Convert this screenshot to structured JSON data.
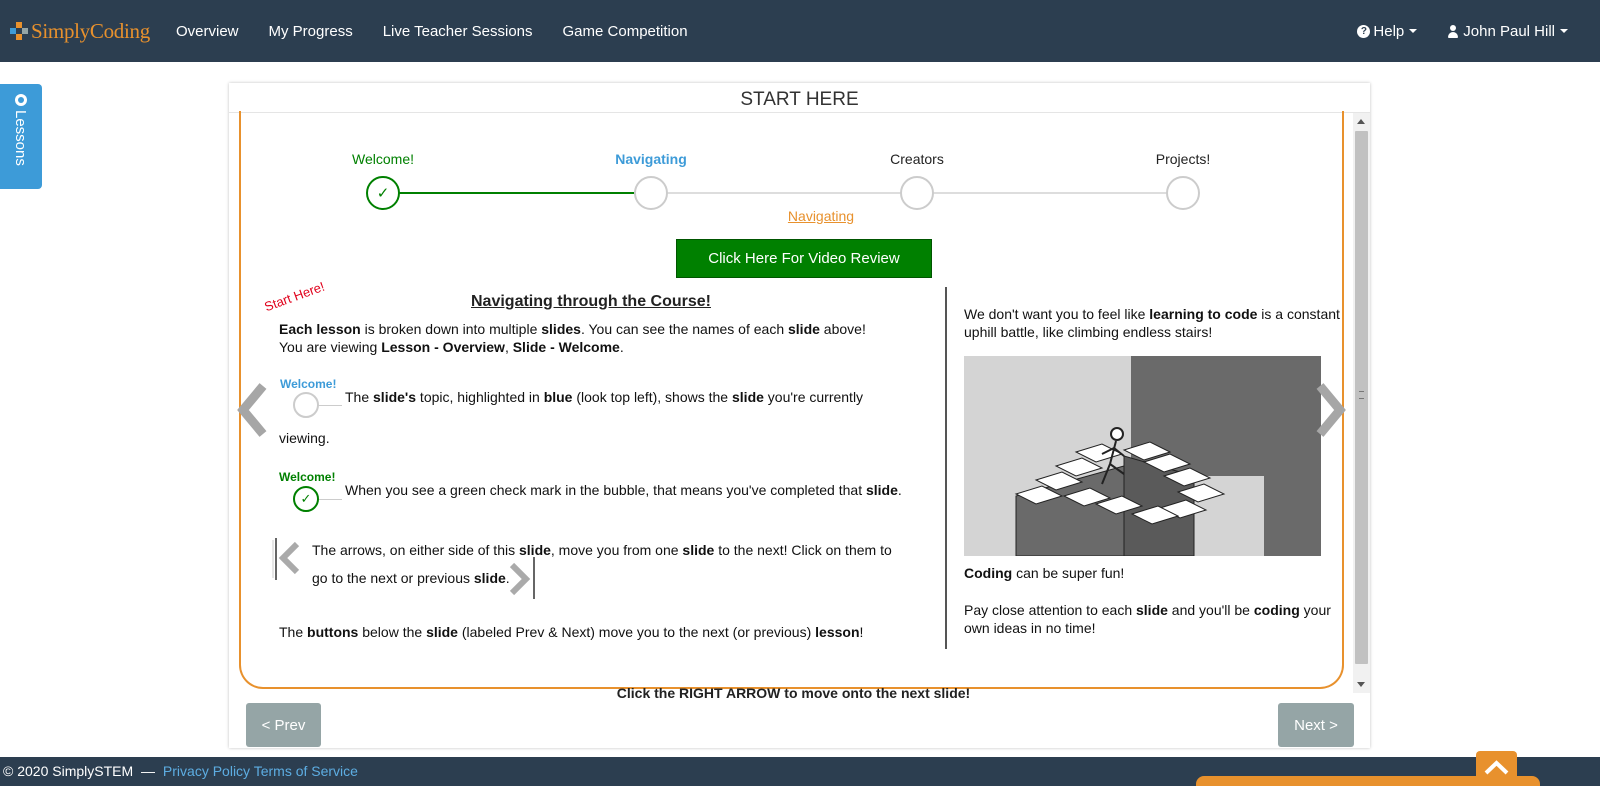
{
  "brand": {
    "name": "SimplyCoding"
  },
  "nav": {
    "links": [
      "Overview",
      "My Progress",
      "Live Teacher Sessions",
      "Game Competition"
    ],
    "help": "Help",
    "user": "John Paul Hill"
  },
  "sidebar": {
    "lessons_tab": "Lessons"
  },
  "panel": {
    "title": "START HERE"
  },
  "steps": [
    {
      "label": "Welcome!",
      "status": "completed",
      "check": "✓"
    },
    {
      "label": "Navigating",
      "status": "current",
      "check": ""
    },
    {
      "label": "Creators",
      "status": "upcoming",
      "check": ""
    },
    {
      "label": "Projects!",
      "status": "upcoming",
      "check": ""
    }
  ],
  "slide": {
    "current_link": "Navigating",
    "video_button": "Click Here For Video Review",
    "start_here": "Start Here!",
    "title": "Navigating through the Course!",
    "demo_label_current": "Welcome!",
    "demo_label_done": "Welcome!",
    "demo_check": "✓",
    "bottom_cta": "Click the RIGHT ARROW to move onto the next slide!",
    "left_paragraphs": [
      "<b>Each lesson</b> is broken down into multiple <b>slides</b>. You can see the names of each <b>slide</b> above!<br>You are viewing <b>Lesson - Overview</b>, <b>Slide - Welcome</b>.",
      "The <b>slide's</b> topic, highlighted in <b>blue</b> (look top left), shows the <b>slide</b> you're currently",
      "viewing.",
      "When you see a green check mark in the bubble, that means you've completed that <b>slide</b>.",
      "The arrows, on either side of this <b>slide</b>, move you from one <b>slide</b> to the next! Click on them to",
      "go to the next or previous <b>slide</b>.",
      "The <b>buttons</b> below the <b>slide</b> (labeled Prev &amp; Next) move you to the next (or previous) <b>lesson</b>!"
    ],
    "right_paragraphs": [
      "We don't want you to feel like <b>learning to code</b> is a constant uphill battle, like climbing endless stairs!",
      "<b>Coding</b> can be super fun!",
      "Pay close attention to each <b>slide</b> and you'll be <b>coding</b> your own ideas in no time!"
    ]
  },
  "buttons": {
    "prev": "< Prev",
    "next": "Next >"
  },
  "footer": {
    "copyright": "© 2020 SimplySTEM",
    "sep": "—",
    "privacy": "Privacy Policy",
    "terms": "Terms of Service"
  },
  "colors": {
    "navbar": "#2c3e50",
    "accent": "#e8912d",
    "completed": "#008000",
    "current": "#3d9bd8",
    "lessons_tab": "#3d9bd8",
    "nav_button": "#95a5a6"
  },
  "icons": [
    "help-icon",
    "user-icon",
    "lessons-icon",
    "check-icon",
    "chevron-left-icon",
    "chevron-right-icon",
    "chevron-up-icon"
  ]
}
